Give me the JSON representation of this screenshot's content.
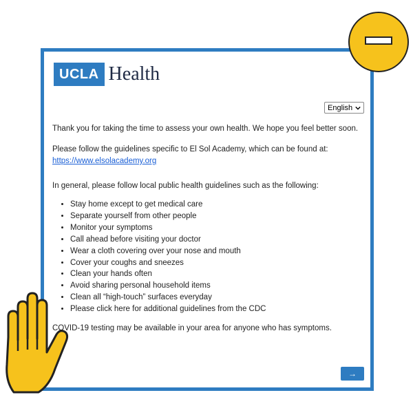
{
  "brand": {
    "logo_box": "UCLA",
    "logo_word": "Health"
  },
  "language": {
    "selected": "English"
  },
  "content": {
    "intro": "Thank you for taking the time to assess your own health. We hope you feel better soon.",
    "guidelines_text": "Please follow the guidelines specific to El Sol Academy, which can be found at:",
    "guidelines_link": "https://www.elsolacademy.org",
    "general": "In general, please follow local public health guidelines such as the following:",
    "list": [
      "Stay home except to get medical care",
      "Separate yourself from other people",
      "Monitor your symptoms",
      "Call ahead before visiting your doctor",
      "Wear a cloth covering over your nose and mouth",
      "Cover your coughs and sneezes",
      "Clean your hands often",
      "Avoid sharing personal household items",
      "Clean all “high-touch” surfaces everyday",
      "Please click here for additional guidelines from the CDC"
    ],
    "testing": "COVID-19 testing may be available in your area for anyone who has symptoms."
  },
  "next_button": {
    "label": "→"
  },
  "overlay": {
    "minus_icon": "minus-circle-icon",
    "hand_icon": "raised-hand-icon",
    "accent_color": "#f6c21c"
  },
  "colors": {
    "brand_blue": "#2e7cc1",
    "link": "#1a5fd6"
  }
}
